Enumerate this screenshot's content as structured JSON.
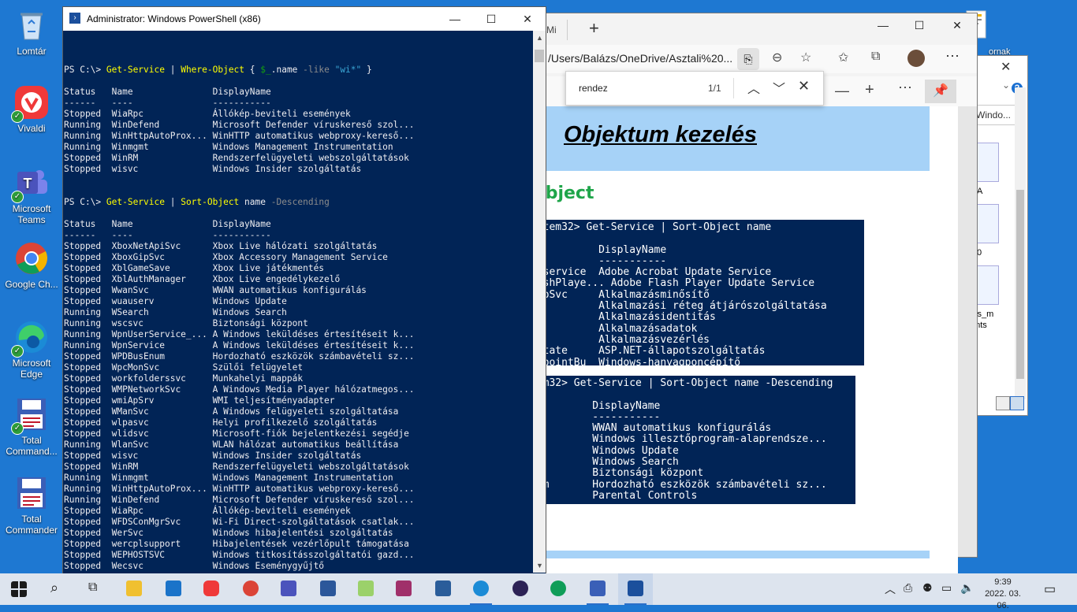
{
  "desktop_icons": [
    {
      "label": "Lomtár",
      "icon": "recycle-bin-icon"
    },
    {
      "label": "Vivaldi",
      "icon": "vivaldi-icon"
    },
    {
      "label": "Microsoft Teams",
      "icon": "teams-icon"
    },
    {
      "label": "Google Ch...",
      "icon": "chrome-icon"
    },
    {
      "label": "Microsoft Edge",
      "icon": "edge-icon"
    },
    {
      "label": "Total Command...",
      "icon": "total-commander-icon"
    },
    {
      "label": "Total Commander",
      "icon": "total-commander-icon"
    }
  ],
  "top_right_icon_label": "ornak",
  "background_window": {
    "tab_label": "Windo...",
    "items": [
      "A",
      "0",
      "cts_m",
      "ents"
    ]
  },
  "edge": {
    "tab_label": "Mi",
    "address": "/Users/Balázs/OneDrive/Asztali%20...",
    "find": {
      "query": "rendez",
      "count": "1/1"
    },
    "page_heading": "Objektum kezelés",
    "section_heading": "Object",
    "code1": [
      "ystem32> Get-Service | Sort-Object name",
      "",
      "           DisplayName",
      "           -----------",
      "RMservice  Adobe Acrobat Update Service",
      "lashPlaye... Adobe Flash Player Update Service",
      "tupSvc     Alkalmazásminősítő",
      "           Alkalmazási réteg átjárószolgáltatása",
      "vc         Alkalmazásidentitás",
      "o          Alkalmazásadatok",
      "t          Alkalmazásvezérlés",
      "_state     ASP.NET-állapotszolgáltatás",
      "ndpointBu  Windows-hanyagponcépítő"
    ],
    "code2": [
      "tem32> Get-Service | Sort-Object name -Descending",
      "",
      "          DisplayName",
      "          -----------",
      "          WWAN automatikus konfigurálás",
      "          Windows illesztőprogram-alaprendsze...",
      "v         Windows Update",
      "          Windows Search",
      "          Biztonsági központ",
      "num       Hordozható eszközök számbavételi sz...",
      "          Parental Controls"
    ]
  },
  "powershell": {
    "title": "Administrator: Windows PowerShell (x86)",
    "prompt": "PS C:\\> ",
    "cmd1": {
      "a": "Get-Service",
      "p1": " | ",
      "b": "Where-Object",
      "p2": " { ",
      "c": "$_",
      "d": ".name ",
      "e": "-like",
      "f": " \"wi*\"",
      "g": " }"
    },
    "cmd2": {
      "a": "Get-Service",
      "p1": " | ",
      "b": "Sort-Object",
      "p2": " name ",
      "c": "-Descending"
    },
    "header": "Status   Name               DisplayName",
    "underline": "------   ----               -----------",
    "table1": [
      "Stopped  WiaRpc             Állókép-beviteli események",
      "Running  WinDefend          Microsoft Defender víruskereső szol...",
      "Running  WinHttpAutoProx... WinHTTP automatikus webproxy-kereső...",
      "Running  Winmgmt            Windows Management Instrumentation",
      "Stopped  WinRM              Rendszerfelügyeleti webszolgáltatások",
      "Stopped  wisvc              Windows Insider szolgáltatás"
    ],
    "table2": [
      "Stopped  XboxNetApiSvc      Xbox Live hálózati szolgáltatás",
      "Stopped  XboxGipSvc         Xbox Accessory Management Service",
      "Stopped  XblGameSave        Xbox Live játékmentés",
      "Stopped  XblAuthManager     Xbox Live engedélykezelő",
      "Stopped  WwanSvc            WWAN automatikus konfigurálás",
      "Stopped  wuauserv           Windows Update",
      "Running  WSearch            Windows Search",
      "Running  wscsvc             Biztonsági központ",
      "Running  WpnUserService_... A Windows leküldéses értesítéseit k...",
      "Running  WpnService         A Windows leküldéses értesítéseit k...",
      "Stopped  WPDBusEnum         Hordozható eszközök számbavételi sz...",
      "Stopped  WpcMonSvc          Szülői felügyelet",
      "Stopped  workfolderssvc     Munkahelyi mappák",
      "Stopped  WMPNetworkSvc      A Windows Media Player hálózatmegos...",
      "Stopped  wmiApSrv           WMI teljesítményadapter",
      "Stopped  WManSvc            A Windows felügyeleti szolgáltatása",
      "Stopped  wlpasvc            Helyi profilkezelő szolgáltatás",
      "Stopped  wlidsvc            Microsoft-fiók bejelentkezési segédje",
      "Running  WlanSvc            WLAN hálózat automatikus beállítása",
      "Stopped  wisvc              Windows Insider szolgáltatás",
      "Stopped  WinRM              Rendszerfelügyeleti webszolgáltatások",
      "Running  Winmgmt            Windows Management Instrumentation",
      "Running  WinHttpAutoProx... WinHTTP automatikus webproxy-kereső...",
      "Running  WinDefend          Microsoft Defender víruskereső szol...",
      "Stopped  WiaRpc             Állókép-beviteli események",
      "Stopped  WFDSConMgrSvc      Wi-Fi Direct-szolgáltatások csatlak...",
      "Stopped  WerSvc             Windows hibajelentési szolgáltatás",
      "Stopped  wercplsupport      Hibajelentések vezérlőpult támogatása",
      "Stopped  WEPHOSTSVC         Windows titkosításszolgáltatói gazd...",
      "Stopped  Wecsvc             Windows Eseménygyűjtő"
    ]
  },
  "taskbar": {
    "time": "9:39",
    "date": "2022. 03. 06.",
    "apps": [
      "start-button",
      "search-icon",
      "task-view-icon",
      "file-explorer-icon",
      "mail-icon",
      "vivaldi-icon",
      "chrome-icon",
      "teams-icon",
      "word-icon",
      "notepad-plus-icon",
      "winrar-icon",
      "virtualbox-icon",
      "edge-icon",
      "eclipse-icon",
      "chrome-profile-icon",
      "total-commander-icon",
      "powershell-icon"
    ]
  },
  "colors": {
    "ps_bg": "#012456",
    "ps_yellow": "#ffff00",
    "ps_gray": "#8b8b8b",
    "accent": "#2a6fc9"
  }
}
